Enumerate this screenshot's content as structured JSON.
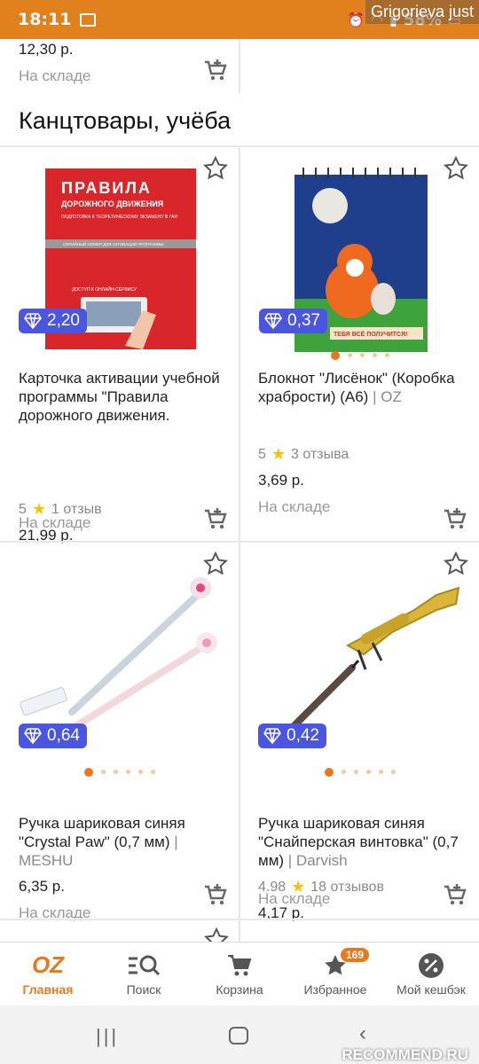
{
  "status_bar": {
    "time": "18:11",
    "battery": "58%",
    "watermark": "Grigorieva just"
  },
  "top_row": {
    "price": "12,30 р.",
    "stock": "На складе"
  },
  "section_title": "Канцтовары, учёба",
  "products": [
    {
      "badge": "2,20",
      "title": "Карточка активации учебной программы \"Правила дорожного движения. Подготовка к т...",
      "brand": "",
      "rating": "5",
      "reviews": "1 отзыв",
      "price": "21,99 р.",
      "stock": "На складе",
      "image_text": {
        "line1": "ПРАВИЛА",
        "line2": "ДОРОЖНОГО ДВИЖЕНИЯ",
        "line3": "ПОДГОТОВКА К ТЕОРЕТИЧЕСКОМУ ЭКЗАМЕНУ В ГАИ",
        "line4": "СЕРИЙНЫЙ НОМЕР ДЛЯ АКТИВАЦИИ ПРОГРАММЫ",
        "line5": "ДОСТУП К ОНЛАЙН-СЕРВИСУ"
      }
    },
    {
      "badge": "0,37",
      "title": "Блокнот \"Лисёнок\" (Коробка храбрости) (А6)",
      "brand": "OZ",
      "rating": "5",
      "reviews": "3 отзыва",
      "price": "3,69 р.",
      "stock": "На складе",
      "image_text": {
        "banner": "ТЕБЯ ВСЁ ПОЛУЧИТСЯ!"
      }
    },
    {
      "badge": "0,64",
      "title": "Ручка шариковая синяя \"Crystal Paw\" (0,7 мм)",
      "brand": "MESHU",
      "price": "6,35 р.",
      "stock": "На складе"
    },
    {
      "badge": "0,42",
      "title": "Ручка шариковая синяя \"Снайперская винтовка\" (0,7 мм)",
      "brand": "Darvish",
      "rating": "4.98",
      "reviews": "18 отзывов",
      "price": "4,17 р.",
      "stock": "На складе"
    }
  ],
  "nav": {
    "home": "Главная",
    "search": "Поиск",
    "cart": "Корзина",
    "favorites": "Избранное",
    "favorites_count": "169",
    "cashback": "Мой кешбэк",
    "logo": "OZ"
  },
  "system_nav": {
    "recents": "|||"
  },
  "site_watermark": "RECOMMEND.RU",
  "colors": {
    "accent": "#e8781c",
    "badge": "#4a55e0",
    "status_bar": "#e0811e"
  }
}
